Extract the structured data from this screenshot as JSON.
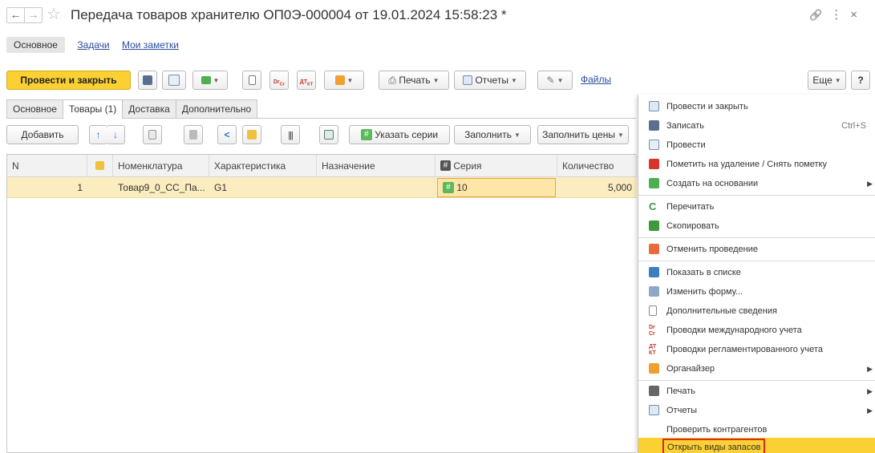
{
  "window": {
    "title": "Передача товаров хранителю ОП0Э-000004 от 19.01.2024 15:58:23 *",
    "back_glyph": "←",
    "forward_glyph": "→",
    "star_glyph": "☆",
    "link_glyph": "🔗",
    "more_glyph": "⋮",
    "close_glyph": "×"
  },
  "sections": {
    "main": "Основное",
    "tasks": "Задачи",
    "notes": "Мои заметки"
  },
  "toolbar": {
    "post_close": "Провести и закрыть",
    "print": "Печать",
    "reports": "Отчеты",
    "files": "Файлы",
    "more": "Еще",
    "help": "?"
  },
  "tabs": [
    {
      "label": "Основное"
    },
    {
      "label": "Товары (1)"
    },
    {
      "label": "Доставка"
    },
    {
      "label": "Дополнительно"
    }
  ],
  "table_toolbar": {
    "add": "Добавить",
    "specify_series": "Указать серии",
    "fill": "Заполнить",
    "fill_prices": "Заполнить цены"
  },
  "table": {
    "columns": [
      "N",
      "",
      "Номенклатура",
      "Характеристика",
      "Назначение",
      "Серия",
      "Количество"
    ],
    "rows": [
      {
        "n": "1",
        "nomenclature": "Товар9_0_СС_Па...",
        "characteristic": "G1",
        "purpose": "",
        "series": "10",
        "quantity": "5,000"
      }
    ]
  },
  "menu": {
    "items": [
      {
        "label": "Провести и закрыть",
        "icon": "post-close-icon"
      },
      {
        "label": "Записать",
        "shortcut": "Ctrl+S",
        "icon": "save-icon"
      },
      {
        "label": "Провести",
        "icon": "post-icon"
      },
      {
        "label": "Пометить на удаление / Снять пометку",
        "icon": "delete-mark-icon"
      },
      {
        "label": "Создать на основании",
        "icon": "create-based-icon",
        "submenu": true
      },
      {
        "label": "Перечитать",
        "icon": "reload-icon"
      },
      {
        "label": "Скопировать",
        "icon": "copy-icon"
      },
      {
        "label": "Отменить проведение",
        "icon": "unpost-icon"
      },
      {
        "label": "Показать в списке",
        "icon": "show-list-icon"
      },
      {
        "label": "Изменить форму...",
        "icon": "change-form-icon"
      },
      {
        "label": "Дополнительные сведения",
        "icon": "additional-info-icon"
      },
      {
        "label": "Проводки международного учета",
        "icon": "intl-entries-icon"
      },
      {
        "label": "Проводки регламентированного учета",
        "icon": "reg-entries-icon"
      },
      {
        "label": "Органайзер",
        "icon": "organizer-icon",
        "submenu": true
      },
      {
        "label": "Печать",
        "icon": "print-icon",
        "submenu": true
      },
      {
        "label": "Отчеты",
        "icon": "reports-icon",
        "submenu": true
      },
      {
        "label": "Проверить контрагентов",
        "icon": ""
      },
      {
        "label": "Открыть виды запасов",
        "icon": "",
        "highlighted": true
      }
    ]
  },
  "colors": {
    "accent_yellow": "#fbd033",
    "link_blue": "#2b4f9a",
    "row_selected": "#fbedc0",
    "highlight_border": "#d92a1c"
  }
}
